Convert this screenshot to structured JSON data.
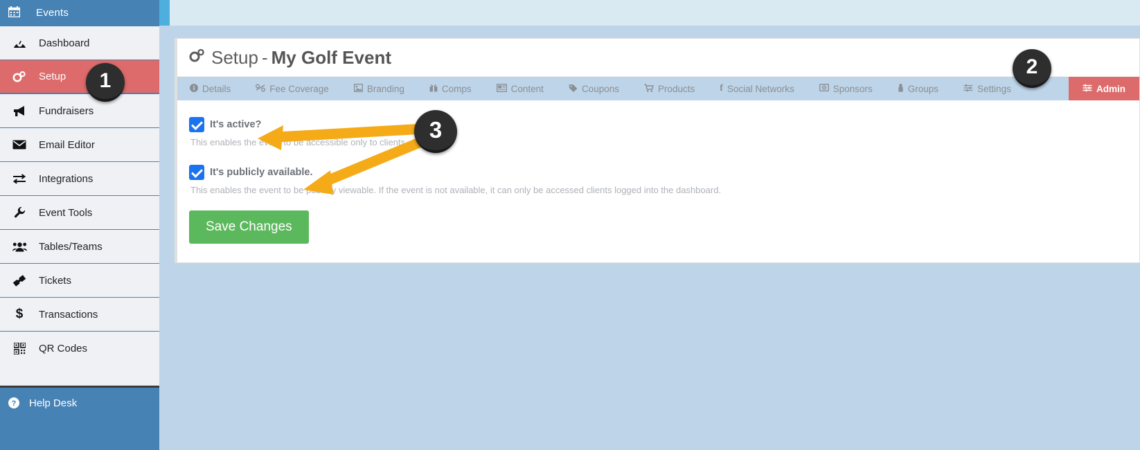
{
  "sidebar": {
    "brand": {
      "label": "Events",
      "icon": "calendar-icon"
    },
    "items": [
      {
        "label": "Dashboard",
        "icon": "dashboard-icon",
        "glyph": "◔",
        "active": false
      },
      {
        "label": "Setup",
        "icon": "gears-icon",
        "glyph": "⚙",
        "active": true
      },
      {
        "label": "Fundraisers",
        "icon": "bullhorn-icon",
        "glyph": "📣",
        "active": false
      },
      {
        "label": "Email Editor",
        "icon": "envelope-icon",
        "glyph": "✉",
        "active": false
      },
      {
        "label": "Integrations",
        "icon": "exchange-icon",
        "glyph": "⇄",
        "active": false
      },
      {
        "label": "Event Tools",
        "icon": "wrench-icon",
        "glyph": "🔧",
        "active": false
      },
      {
        "label": "Tables/Teams",
        "icon": "users-icon",
        "glyph": "👥",
        "active": false
      },
      {
        "label": "Tickets",
        "icon": "ticket-icon",
        "glyph": "🎟",
        "active": false
      },
      {
        "label": "Transactions",
        "icon": "dollar-icon",
        "glyph": "$",
        "active": false
      },
      {
        "label": "QR Codes",
        "icon": "qrcode-icon",
        "glyph": "▒",
        "active": false
      }
    ],
    "help": {
      "label": "Help Desk",
      "icon": "question-circle-icon",
      "glyph": "?"
    }
  },
  "page": {
    "title_prefix": "Setup",
    "title_dash": "-",
    "title_event": "My Golf Event",
    "title_icon": "gears-icon"
  },
  "tabs": [
    {
      "label": "Details",
      "icon": "info-circle-icon",
      "glyph": "ℹ",
      "active": false
    },
    {
      "label": "Fee Coverage",
      "icon": "percent-icon",
      "glyph": "⚖",
      "active": false
    },
    {
      "label": "Branding",
      "icon": "image-icon",
      "glyph": "🖼",
      "active": false
    },
    {
      "label": "Comps",
      "icon": "gift-icon",
      "glyph": "🎁",
      "active": false
    },
    {
      "label": "Content",
      "icon": "newspaper-icon",
      "glyph": "📰",
      "active": false
    },
    {
      "label": "Coupons",
      "icon": "tag-icon",
      "glyph": "🏷",
      "active": false
    },
    {
      "label": "Products",
      "icon": "cart-icon",
      "glyph": "🛒",
      "active": false
    },
    {
      "label": "Social Networks",
      "icon": "facebook-f-icon",
      "glyph": "f",
      "active": false
    },
    {
      "label": "Sponsors",
      "icon": "id-card-icon",
      "glyph": "💳",
      "active": false
    },
    {
      "label": "Groups",
      "icon": "person-icon",
      "glyph": "👤",
      "active": false
    },
    {
      "label": "Settings",
      "icon": "sliders-icon",
      "glyph": "≡",
      "active": false
    },
    {
      "label": "Admin",
      "icon": "sliders-icon",
      "glyph": "≡",
      "active": true
    }
  ],
  "form": {
    "active": {
      "label": "It's active?",
      "checked": true,
      "help": "This enables the event to be accessible only to clients."
    },
    "public": {
      "label": "It's publicly available.",
      "checked": true,
      "help": "This enables the event to be publicly viewable. If the event is not available, it can only be accessed clients logged into the dashboard."
    },
    "save_label": "Save Changes"
  },
  "annotations": {
    "badge1": "1",
    "badge2": "2",
    "badge3": "3",
    "arrow_color": "#f5ab18"
  },
  "colors": {
    "sidebar_bg": "#eff1f5",
    "brand_blue": "#4682b4",
    "active_red": "#dd6b6b",
    "page_bg": "#bed4e8",
    "save_green": "#5cb85c",
    "checkbox_blue": "#1a73f0"
  }
}
